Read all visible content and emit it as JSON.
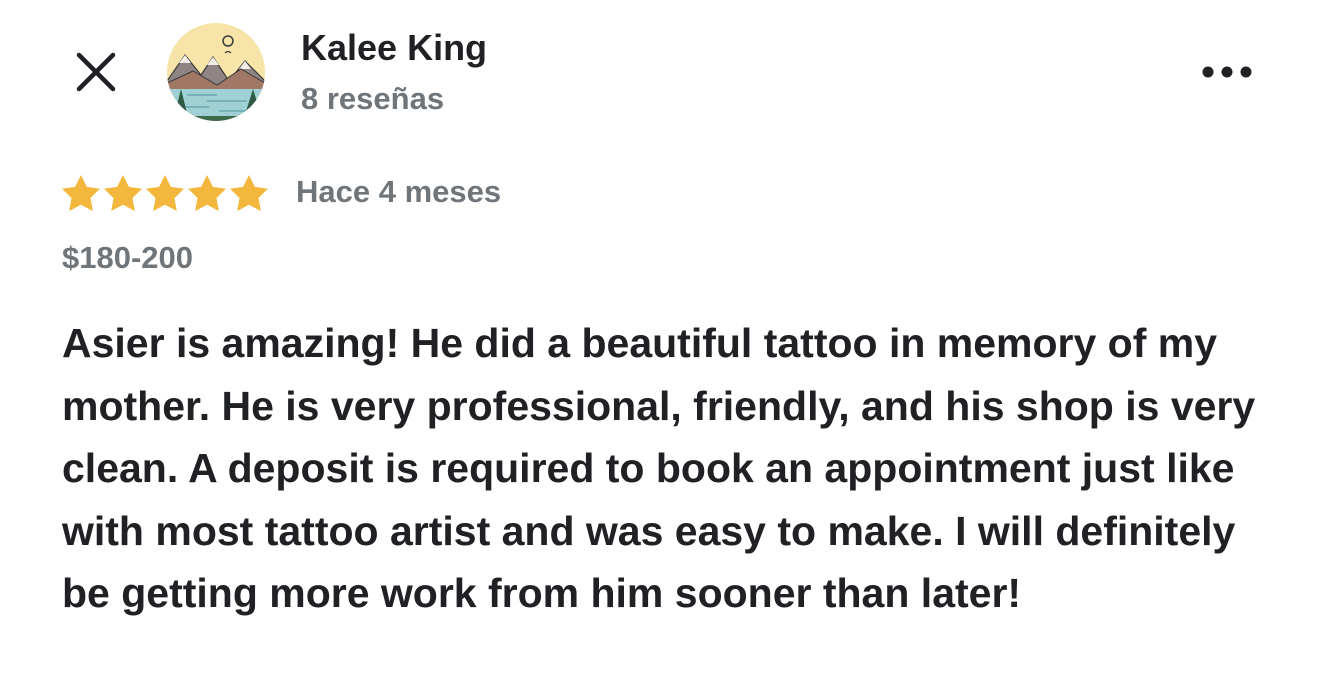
{
  "reviewer": {
    "name": "Kalee King",
    "review_count": "8 reseñas",
    "avatar_icon": "mountain-lake-landscape"
  },
  "review": {
    "rating": 5,
    "rating_max": 5,
    "time_ago": "Hace 4 meses",
    "price_range": "$180-200",
    "text": "Asier is amazing! He did a beautiful tattoo in memory of my mother. He is very professional, friendly, and his shop is very clean. A deposit is required to book an appointment just like with most tattoo artist and was easy to make. I will definitely be getting more work from him sooner than later!"
  },
  "icons": {
    "close": "close-icon",
    "more": "more-options-icon",
    "star": "star-icon"
  },
  "colors": {
    "star": "#f4b73d",
    "primary_text": "#202124",
    "secondary_text": "#70757a",
    "background": "#ffffff"
  }
}
